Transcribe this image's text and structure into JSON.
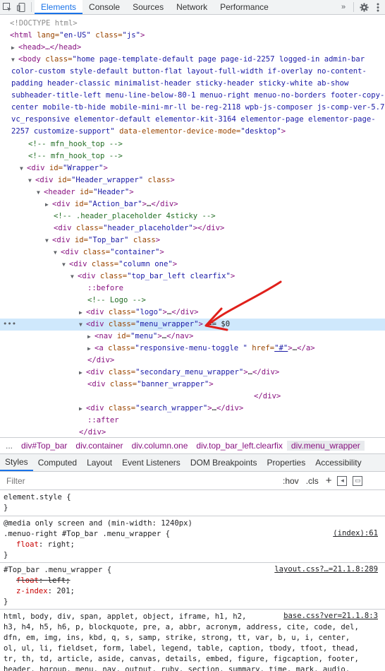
{
  "toolbar": {
    "tabs": [
      "Elements",
      "Console",
      "Sources",
      "Network",
      "Performance"
    ],
    "active_tab": "Elements"
  },
  "tree": {
    "doctype": "<!DOCTYPE html>",
    "html_open": [
      "<html",
      " lang=",
      "\"en-US\"",
      " class=",
      "\"js\"",
      ">"
    ],
    "head": "<head>…</head>",
    "body_class": "\"home page-template-default page page-id-2257 logged-in admin-bar color-custom style-default button-flat layout-full-width if-overlay no-content-padding header-classic minimalist-header sticky-header sticky-white ab-show subheader-title-left menu-line-below-80-1 menuo-right menuo-no-borders footer-copy-center mobile-tb-hide mobile-mini-mr-ll be-reg-2118 wpb-js-composer js-comp-ver-5.7 vc_responsive elementor-default elementor-kit-3164 elementor-page elementor-page-2257 customize-support\"",
    "body_attr2": " data-elementor-device-mode=",
    "body_attr2_val": "\"desktop\"",
    "comment1": "<!-- mfn_hook_top -->",
    "comment2": "<!-- mfn_hook_top -->",
    "wrapper": "\"Wrapper\"",
    "header_wrapper": "\"Header_wrapper\"",
    "header_id": "\"Header\"",
    "action_bar": "\"Action_bar\"",
    "comment3": "<!-- .header_placeholder 4sticky  -->",
    "header_placeholder": "\"header_placeholder\"",
    "top_bar": "\"Top_bar\"",
    "container": "\"container\"",
    "column_one": "\"column one\"",
    "top_bar_left": "\"top_bar_left clearfix\"",
    "before": "::before",
    "comment_logo": "<!-- Logo -->",
    "logo": "\"logo\"",
    "menu_wrapper": "\"menu_wrapper\"",
    "eq0": "== $0",
    "nav_menu": "\"menu\"",
    "resp_toggle": "\"responsive-menu-toggle \"",
    "href": "\"#\"",
    "secondary": "\"secondary_menu_wrapper\"",
    "banner": "\"banner_wrapper\"",
    "search": "\"search_wrapper\"",
    "after": "::after"
  },
  "breadcrumbs": [
    "...",
    "div#Top_bar",
    "div.container",
    "div.column.one",
    "div.top_bar_left.clearfix",
    "div.menu_wrapper"
  ],
  "subtabs": [
    "Styles",
    "Computed",
    "Layout",
    "Event Listeners",
    "DOM Breakpoints",
    "Properties",
    "Accessibility"
  ],
  "filter": {
    "placeholder": "Filter",
    "hov": ":hov",
    "cls": ".cls",
    "plus": "+"
  },
  "styles": {
    "element_style": "element.style {",
    "close": "}",
    "media": "@media only screen and (min-width: 1240px)",
    "rule1_sel": ".menuo-right #Top_bar .menu_wrapper {",
    "rule1_src": "(index):61",
    "rule1_prop": "float",
    "rule1_val": "right;",
    "rule2_sel": "#Top_bar .menu_wrapper {",
    "rule2_src": "layout.css?…=21.1.8:289",
    "rule2_p1": "float",
    "rule2_v1": "left;",
    "rule2_p2": "z-index",
    "rule2_v2": "201;",
    "rule3_src": "base.css?ver=21.1.8:3",
    "rule3_lines": [
      "html, body, div, span, applet, object, iframe, h1, h2,",
      "h3, h4, h5, h6, p, blockquote, pre, a, abbr, acronym, address, cite, code, del,",
      "dfn, em, img, ins, kbd, q, s, samp, strike, strong, tt, var, b, u, i, center,",
      "ol, ul, li, fieldset, form, label, legend, table, caption, tbody, tfoot, thead,",
      "tr, th, td, article, aside, canvas, details, embed, figure, figcaption, footer,",
      "header, hgroup, menu, nav, output, ruby, section, summary, time, mark, audio,"
    ]
  },
  "colors": {
    "accent": "#1a73e8",
    "selected_row": "#cfe8fc",
    "tag": "#881280",
    "annotation_arrow": "#e0201b"
  }
}
